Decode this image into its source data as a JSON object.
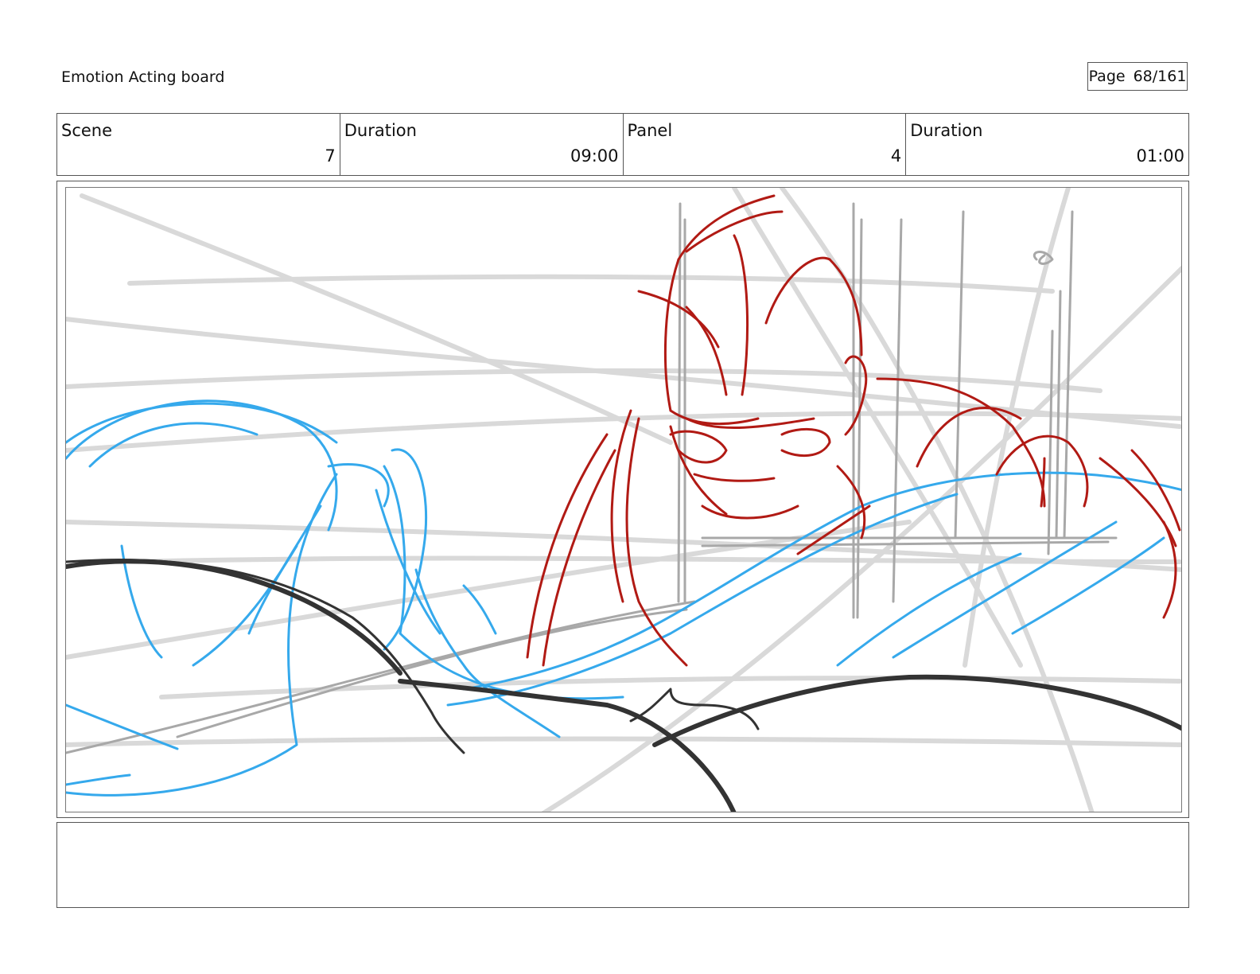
{
  "header": {
    "doc_title": "Emotion Acting board",
    "page_label": "Page",
    "page_value": "68/161"
  },
  "info": {
    "scene_label": "Scene",
    "scene_value": "7",
    "scene_duration_label": "Duration",
    "scene_duration_value": "09:00",
    "panel_label": "Panel",
    "panel_value": "4",
    "panel_duration_label": "Duration",
    "panel_duration_value": "01:00"
  },
  "sketch_colors": {
    "construction": "#d9d9d9",
    "background": "#a8a8a8",
    "character_a": "#35a9ec",
    "character_b": "#b11a14",
    "foreground": "#333333"
  },
  "notes": ""
}
